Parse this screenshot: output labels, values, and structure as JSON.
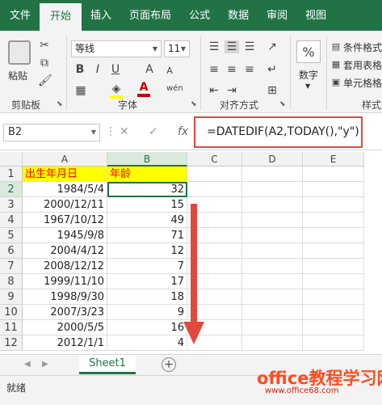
{
  "ribbon_tabs": [
    {
      "label": "文件"
    },
    {
      "label": "开始",
      "active": true
    },
    {
      "label": "插入"
    },
    {
      "label": "页面布局"
    },
    {
      "label": "公式"
    },
    {
      "label": "数据"
    },
    {
      "label": "审阅"
    },
    {
      "label": "视图"
    }
  ],
  "clipboard": {
    "paste_label": "粘贴",
    "group_label": "剪贴板"
  },
  "font": {
    "name": "等线",
    "size": "11",
    "group_label": "字体",
    "bold": "B",
    "italic": "I",
    "underline": "U",
    "grow": "A",
    "shrink": "A"
  },
  "alignment": {
    "group_label": "对齐方式"
  },
  "number": {
    "format_symbol": "%",
    "label": "数字"
  },
  "styles": {
    "conditional": "条件格式",
    "table": "套用表格",
    "cell": "单元格格",
    "group_label": "样式"
  },
  "formula_bar": {
    "name_box": "B2",
    "fx": "fx",
    "formula": "=DATEDIF(A2,TODAY(),\"y\")"
  },
  "columns": [
    "A",
    "B",
    "C",
    "D",
    "E"
  ],
  "rows": [
    {
      "num": "1",
      "a": "出生年月日",
      "b": "年龄"
    },
    {
      "num": "2",
      "a": "1984/5/4",
      "b": "32"
    },
    {
      "num": "3",
      "a": "2000/12/11",
      "b": "15"
    },
    {
      "num": "4",
      "a": "1967/10/12",
      "b": "49"
    },
    {
      "num": "5",
      "a": "1945/9/8",
      "b": "71"
    },
    {
      "num": "6",
      "a": "2004/4/12",
      "b": "12"
    },
    {
      "num": "7",
      "a": "2008/12/12",
      "b": "7"
    },
    {
      "num": "8",
      "a": "1999/11/10",
      "b": "17"
    },
    {
      "num": "9",
      "a": "1998/9/30",
      "b": "18"
    },
    {
      "num": "10",
      "a": "2007/3/23",
      "b": "9"
    },
    {
      "num": "11",
      "a": "2000/5/5",
      "b": "16"
    },
    {
      "num": "12",
      "a": "2012/1/1",
      "b": "4"
    }
  ],
  "sheet_tab": "Sheet1",
  "status": "就绪",
  "watermark": {
    "main": "office教程学习网",
    "sub": "www.office68.com"
  },
  "colors": {
    "accent": "#217346",
    "highlight": "#e04a3c",
    "header_fill": "#ffff00",
    "header_text": "#ff0000"
  }
}
